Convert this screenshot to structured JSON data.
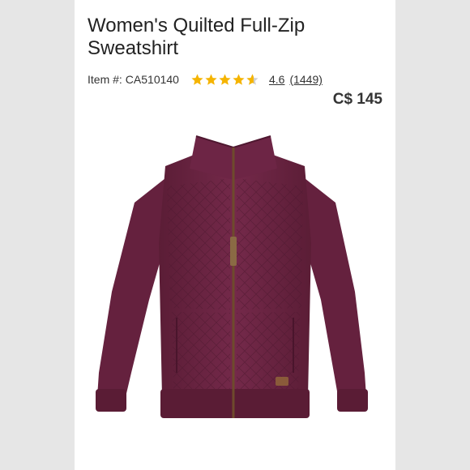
{
  "product": {
    "title": "Women's Quilted Full-Zip Sweatshirt",
    "item_label": "Item #:",
    "item_number": "CA510140",
    "rating": 4.6,
    "rating_text": "4.6",
    "review_count": "(1449)",
    "price": "C$ 145",
    "image_icon": "sweatshirt-image",
    "colors": {
      "star": "#f5b400",
      "garment": "#6b2440"
    }
  }
}
